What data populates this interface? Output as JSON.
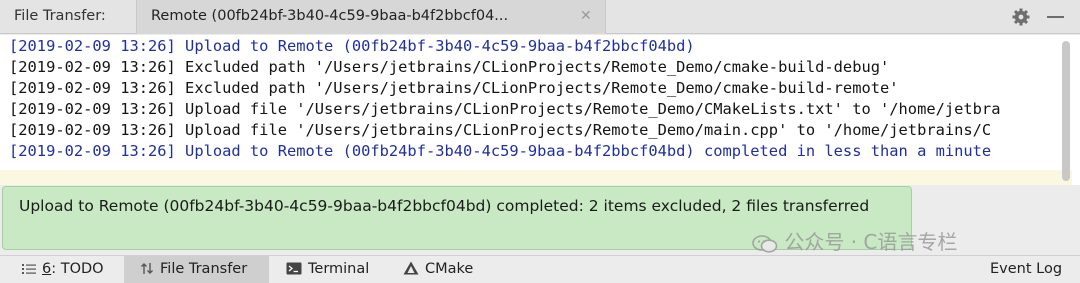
{
  "header": {
    "panel_label": "File Transfer:",
    "tab_label": "Remote (00fb24bf-3b40-4c59-9baa-b4f2bbcf04...",
    "tab_close_icon": "close-icon",
    "settings_icon": "gear-icon",
    "minimize_icon": "minimize-icon"
  },
  "console": {
    "lines": [
      {
        "text": "[2019-02-09 13:26] Upload to Remote (00fb24bf-3b40-4c59-9baa-b4f2bbcf04bd)",
        "color": "#1f2fa3"
      },
      {
        "text": "[2019-02-09 13:26] Excluded path '/Users/jetbrains/CLionProjects/Remote_Demo/cmake-build-debug'",
        "color": "#141414"
      },
      {
        "text": "[2019-02-09 13:26] Excluded path '/Users/jetbrains/CLionProjects/Remote_Demo/cmake-build-remote'",
        "color": "#141414"
      },
      {
        "text": "[2019-02-09 13:26] Upload file '/Users/jetbrains/CLionProjects/Remote_Demo/CMakeLists.txt' to '/home/jetbra",
        "color": "#141414"
      },
      {
        "text": "[2019-02-09 13:26] Upload file '/Users/jetbrains/CLionProjects/Remote_Demo/main.cpp' to '/home/jetbrains/C",
        "color": "#141414"
      },
      {
        "text": "[2019-02-09 13:26] Upload to Remote (00fb24bf-3b40-4c59-9baa-b4f2bbcf04bd) completed in less than a minute",
        "color": "#1f2fa3"
      }
    ]
  },
  "notification": {
    "text": "Upload to Remote (00fb24bf-3b40-4c59-9baa-b4f2bbcf04bd) completed: 2 items excluded, 2 files transferred",
    "background": "#c8e9c3"
  },
  "watermark": {
    "text": "公众号 · C语言专栏"
  },
  "statusbar": {
    "todo_number": "6",
    "todo_label": ": TODO",
    "file_transfer_label": "File Transfer",
    "terminal_label": "Terminal",
    "cmake_label": "CMake",
    "event_log_label": "Event Log"
  }
}
